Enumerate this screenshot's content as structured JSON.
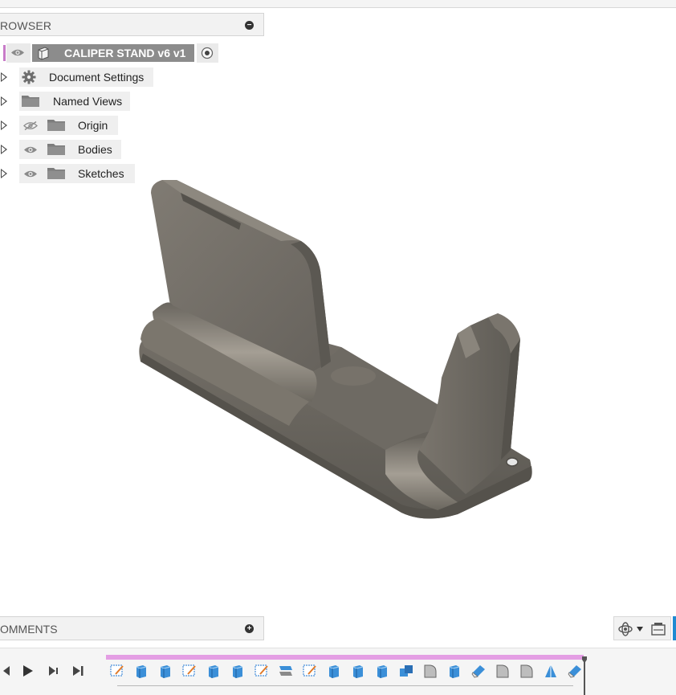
{
  "browser": {
    "title": "ROWSER",
    "collapse_icon": "minus-circle-icon",
    "root": {
      "label": "CALIPER STAND v6 v1",
      "visibility": "visible",
      "icon": "component-icon",
      "activate_icon": "radio-target-icon"
    },
    "items": [
      {
        "label": "Document Settings",
        "icon": "gear-icon"
      },
      {
        "label": "Named Views",
        "icon": "folder-icon"
      },
      {
        "label": "Origin",
        "icon": "folder-icon",
        "visibility": "hidden"
      },
      {
        "label": "Bodies",
        "icon": "folder-icon",
        "visibility": "visible"
      },
      {
        "label": "Sketches",
        "icon": "folder-icon",
        "visibility": "visible"
      }
    ]
  },
  "comments": {
    "title": "OMMENTS",
    "add_icon": "plus-circle-icon"
  },
  "viewport": {
    "model_color": "#6e6a63",
    "model_icon": "3d-model-caliper-stand"
  },
  "navigation": {
    "orbit_icon": "orbit-icon",
    "display_icon": "display-settings-icon",
    "accent": "#1f8ad2"
  },
  "timeline": {
    "controls": [
      "step-back-icon",
      "play-icon",
      "step-forward-icon",
      "go-to-end-icon"
    ],
    "track_color": "#e49ee4",
    "features": [
      "sketch",
      "extrude",
      "extrude",
      "sketch",
      "extrude",
      "extrude",
      "sketch",
      "split",
      "sketch",
      "extrude",
      "extrude",
      "extrude",
      "combine",
      "fillet",
      "extrude",
      "chamfer",
      "fillet",
      "fillet",
      "draft",
      "chamfer"
    ]
  }
}
